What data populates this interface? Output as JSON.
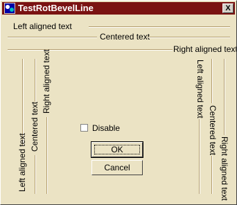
{
  "window": {
    "title": "TestRotBevelLine",
    "close_glyph": "X"
  },
  "horizontal": {
    "left": "Left aligned text",
    "center": "Centered text",
    "right": "Right aligned text"
  },
  "vertical_up": {
    "left": "Left aligned text",
    "center": "Centered text",
    "right": "Right aligned text"
  },
  "vertical_down": {
    "left": "Left aligned text",
    "center": "Centered text",
    "right": "Right aligned text"
  },
  "checkbox": {
    "label": "Disable",
    "checked": false
  },
  "buttons": {
    "ok": "OK",
    "cancel": "Cancel"
  },
  "colors": {
    "titlebar": "#7A1212",
    "face": "#EBE3C4",
    "bevel_dark": "#B39C6B"
  }
}
